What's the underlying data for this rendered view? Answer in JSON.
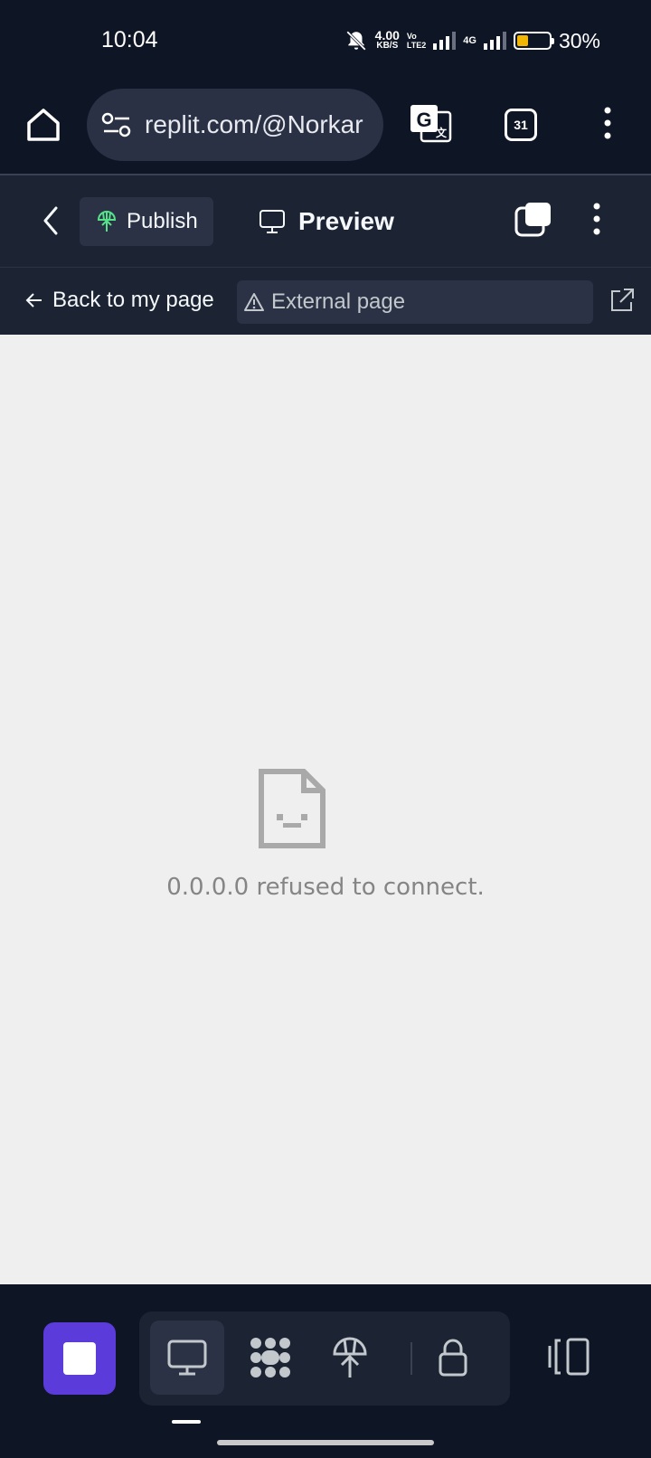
{
  "status_bar": {
    "time": "10:04",
    "speed_value": "4.00",
    "speed_unit": "KB/S",
    "volte_top": "Vo",
    "volte_bottom": "LTE2",
    "network": "4G",
    "battery_percent": "30%",
    "battery_level": 0.3
  },
  "browser": {
    "url": "replit.com/@Norkar",
    "tab_count": "31"
  },
  "replit_header": {
    "publish_label": "Publish",
    "preview_label": "Preview"
  },
  "url_row": {
    "back_label": "Back to my page",
    "address_label": "External page"
  },
  "content": {
    "error_message": "0.0.0.0 refused to connect."
  },
  "colors": {
    "background": "#0e1525",
    "panel": "#1c2333",
    "accent_purple": "#5b3bd9",
    "publish_green": "#57e389",
    "webview_bg": "#efefef"
  }
}
